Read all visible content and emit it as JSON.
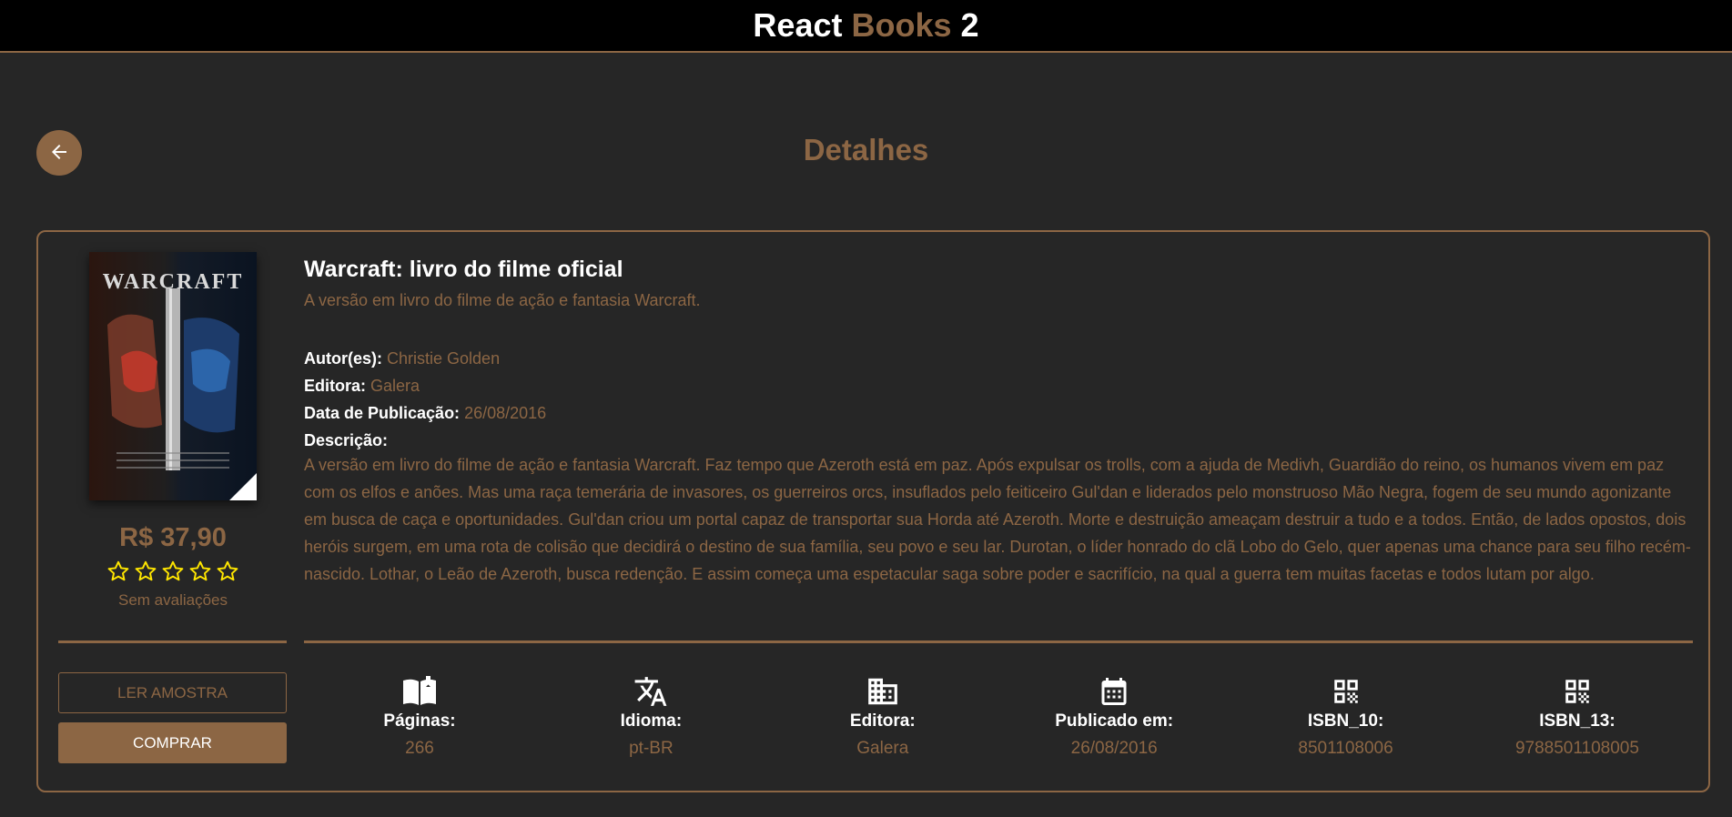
{
  "header": {
    "brand_part1": "React",
    "brand_part2": "Books",
    "brand_part3": "2",
    "accent_color": "#8c6644"
  },
  "page": {
    "title": "Detalhes",
    "back_icon": "arrow-left-icon"
  },
  "book": {
    "cover_text": "WARCRAFT",
    "price": "R$ 37,90",
    "rating": 0,
    "rating_max": 5,
    "rating_text": "Sem avaliações",
    "title": "Warcraft: livro do filme oficial",
    "subtitle": "A versão em livro do filme de ação e fantasia Warcraft.",
    "authors_label": "Autor(es):",
    "authors": "Christie Golden",
    "publisher_label": "Editora:",
    "publisher": "Galera",
    "pub_date_label": "Data de Publicação:",
    "pub_date": "26/08/2016",
    "description_label": "Descrição:",
    "description": "A versão em livro do filme de ação e fantasia Warcraft. Faz tempo que Azeroth está em paz. Após expulsar os trolls, com a ajuda de Medivh, Guardião do reino, os humanos vivem em paz com os elfos e anões. Mas uma raça temerária de invasores, os guerreiros orcs, insuflados pelo feiticeiro Gul'dan e liderados pelo monstruoso Mão Negra, fogem de seu mundo agonizante em busca de caça e oportunidades. Gul'dan criou um portal capaz de transportar sua Horda até Azeroth. Morte e destruição ameaçam destruir a tudo e a todos. Então, de lados opostos, dois heróis surgem, em uma rota de colisão que decidirá o destino de sua família, seu povo e seu lar. Durotan, o líder honrado do clã Lobo do Gelo, quer apenas uma chance para seu filho recém-nascido. Lothar, o Leão de Azeroth, busca redenção. E assim começa uma espetacular saga sobre poder e sacrifício, na qual a guerra tem muitas facetas e todos lutam por algo."
  },
  "actions": {
    "sample_label": "Ler amostra",
    "buy_label": "Comprar"
  },
  "info": [
    {
      "icon": "open-book-icon",
      "label": "Páginas:",
      "value": "266"
    },
    {
      "icon": "translate-icon",
      "label": "Idioma:",
      "value": "pt-BR"
    },
    {
      "icon": "building-icon",
      "label": "Editora:",
      "value": "Galera"
    },
    {
      "icon": "calendar-icon",
      "label": "Publicado em:",
      "value": "26/08/2016"
    },
    {
      "icon": "qr-code-icon",
      "label": "ISBN_10:",
      "value": "8501108006"
    },
    {
      "icon": "qr-code-icon",
      "label": "ISBN_13:",
      "value": "9788501108005"
    }
  ]
}
